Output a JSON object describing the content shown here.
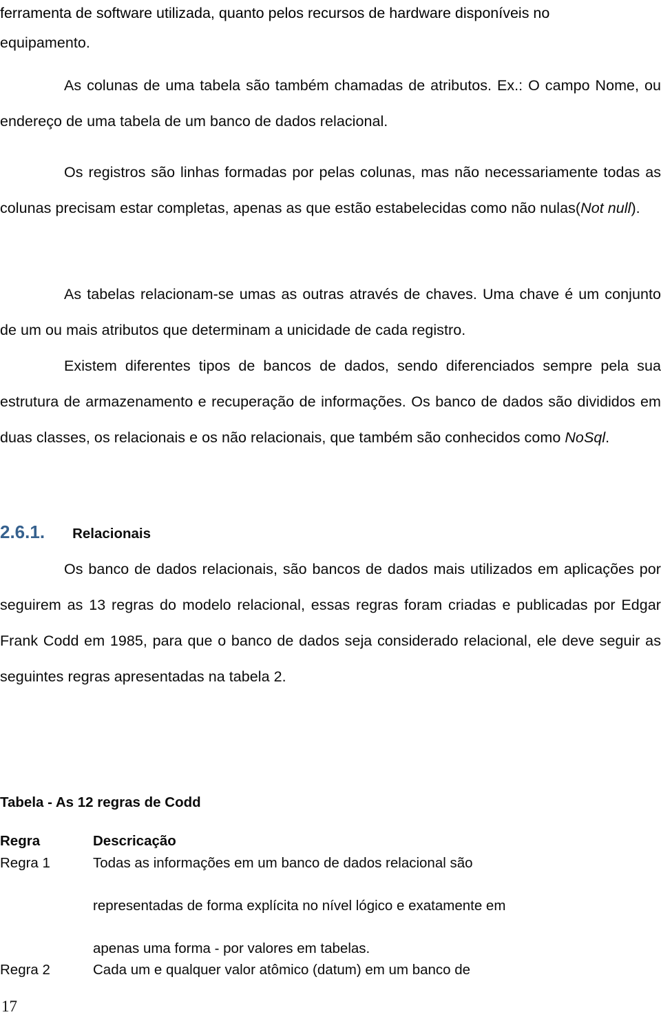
{
  "document": {
    "language": "pt-BR",
    "page_number": "17",
    "accent_color": "#36618E",
    "text_color": "#0a0a0a",
    "background_color": "#ffffff"
  },
  "body": {
    "continuation_paragraph": {
      "line_1": "ferramenta de software utilizada, quanto pelos recursos de hardware disponíveis no",
      "line_2": "equipamento."
    },
    "paragraphs": [
      {
        "id": "colunas-atributos",
        "text_before_italic": "As colunas de uma tabela são também chamadas de atributos. Ex.: O campo Nome, ou endereço de uma tabela de um banco de dados relacional."
      },
      {
        "id": "registros-linhas",
        "text_before_italic": "Os registros são linhas formadas por pelas colunas, mas não necessariamente todas as colunas precisam estar completas, apenas as que estão estabelecidas como não nulas(",
        "italic": "Not null",
        "text_after_italic": ")."
      },
      {
        "id": "tabelas-chaves",
        "text_before_italic": "As tabelas relacionam-se umas as outras através de chaves. Uma chave é um conjunto de um ou mais atributos que determinam a unicidade de cada registro."
      },
      {
        "id": "tipos-de-bancos",
        "text_before_italic": "Existem diferentes tipos de bancos de dados, sendo diferenciados sempre pela sua estrutura de armazenamento e recuperação de informações. Os banco de dados são divididos em duas classes, os relacionais e os não relacionais, que também são conhecidos como ",
        "italic": "NoSql",
        "text_after_italic": "."
      }
    ]
  },
  "heading": {
    "number": "2.6.1.",
    "title": "Relacionais"
  },
  "section_body": {
    "paragraph": "Os banco de dados relacionais, são bancos de dados mais utilizados em aplicações por seguirem as 13 regras do modelo relacional, essas regras foram criadas e publicadas por Edgar Frank Codd em 1985, para que o banco de dados seja considerado relacional, ele deve seguir as seguintes regras apresentadas na tabela 2."
  },
  "table": {
    "caption": "Tabela  - As 12 regras de Codd",
    "columns": [
      "Regra",
      "Descricação"
    ],
    "rows": [
      {
        "rule": "Regra 1",
        "description_line_1": "Todas as informações em um banco de dados relacional são",
        "description_line_2": "representadas de forma explícita no nível lógico e exatamente em",
        "description_line_3": "apenas uma forma - por valores em tabelas."
      },
      {
        "rule": "Regra 2",
        "description_line_1": "Cada um e qualquer valor atômico (datum) em um banco de"
      }
    ]
  }
}
